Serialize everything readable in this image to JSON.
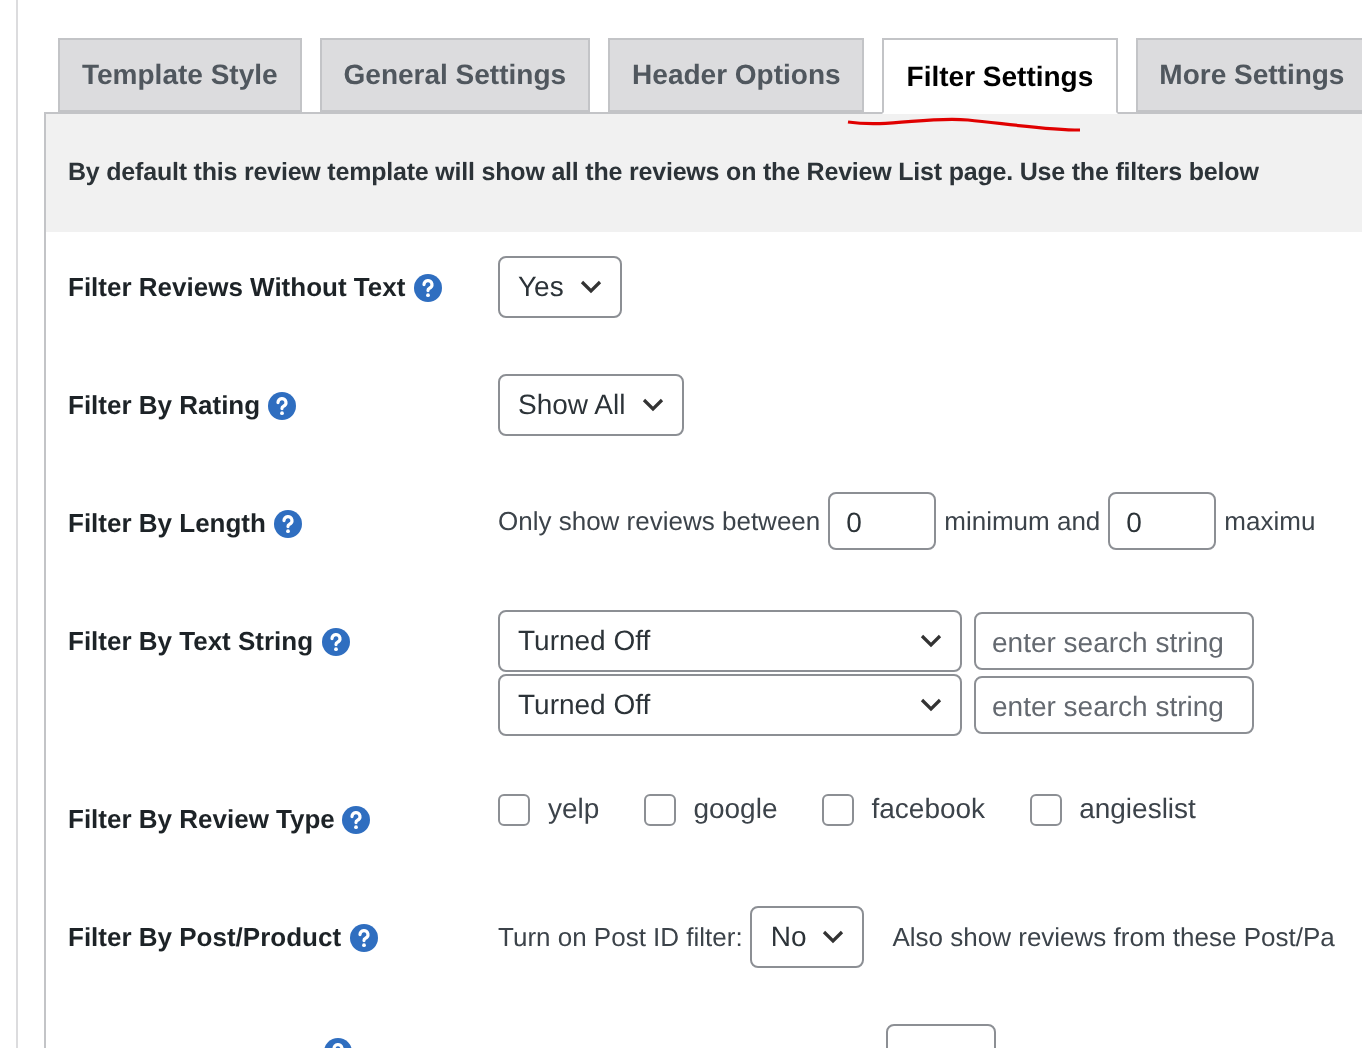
{
  "tabs": [
    {
      "label": "Template Style",
      "selected": false
    },
    {
      "label": "General Settings",
      "selected": false
    },
    {
      "label": "Header Options",
      "selected": false
    },
    {
      "label": "Filter Settings",
      "selected": true
    },
    {
      "label": "More Settings",
      "selected": false
    }
  ],
  "intro": "By default this review template will show all the reviews on the Review List page. Use the filters below",
  "rows": [
    {
      "kind": "select",
      "label": "Filter Reviews Without Text",
      "value": "Yes"
    },
    {
      "kind": "select",
      "label": "Filter By Rating",
      "value": "Show All"
    },
    {
      "kind": "length",
      "label": "Filter By Length",
      "before": "Only show reviews between",
      "min": "0",
      "middle": "minimum and",
      "max": "0",
      "after": "maximu"
    },
    {
      "kind": "textstring",
      "label": "Filter By Text String",
      "lines": [
        {
          "value": "Turned Off",
          "placeholder": "enter search string"
        },
        {
          "value": "Turned Off",
          "placeholder": "enter search string"
        }
      ]
    },
    {
      "kind": "checkboxes",
      "label": "Filter By Review Type",
      "options": [
        {
          "label": "yelp",
          "checked": false
        },
        {
          "label": "google",
          "checked": false
        },
        {
          "label": "facebook",
          "checked": false
        },
        {
          "label": "angieslist",
          "checked": false
        }
      ]
    },
    {
      "kind": "postid",
      "label": "Filter By Post/Product",
      "before": "Turn on Post ID filter:",
      "value": "No",
      "after": "Also show reviews from these Post/Pa"
    },
    {
      "kind": "partial"
    }
  ]
}
